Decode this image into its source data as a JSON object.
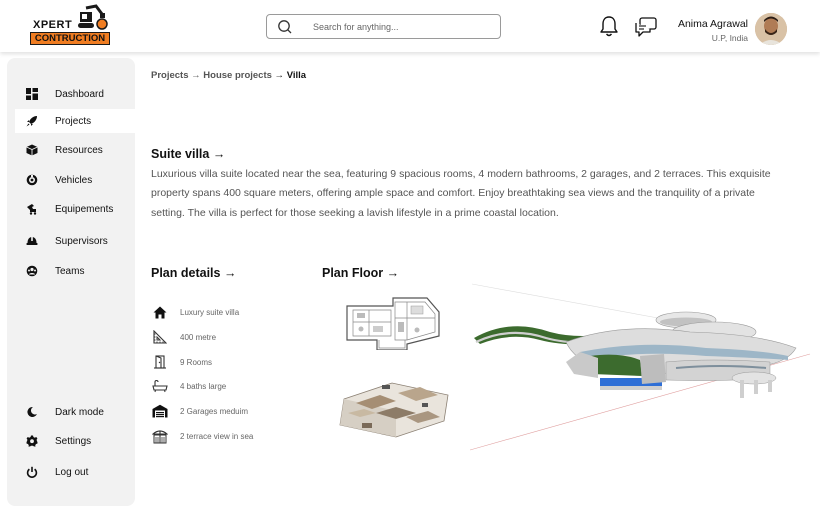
{
  "brand": {
    "logo_top": "XPERT",
    "logo_bottom": "CONTRUCTION"
  },
  "search": {
    "placeholder": "Search for anything..."
  },
  "header": {
    "icons": [
      "bell-icon",
      "chat-icon"
    ],
    "user": {
      "name": "Anima Agrawal",
      "location": "U.P, India"
    }
  },
  "sidebar": {
    "items": [
      {
        "label": "Dashboard",
        "icon": "grid-icon",
        "active": false
      },
      {
        "label": "Projects",
        "icon": "rocket-icon",
        "active": true
      },
      {
        "label": "Resources",
        "icon": "box-icon",
        "active": false
      },
      {
        "label": "Vehicles",
        "icon": "vehicle-icon",
        "active": false
      },
      {
        "label": "Equipements",
        "icon": "equipment-icon",
        "active": false
      },
      {
        "label": "Supervisors",
        "icon": "helmet-icon",
        "active": false
      },
      {
        "label": "Teams",
        "icon": "team-icon",
        "active": false
      }
    ],
    "bottom": [
      {
        "label": "Dark mode",
        "icon": "moon-icon"
      },
      {
        "label": "Settings",
        "icon": "gear-icon"
      },
      {
        "label": "Log out",
        "icon": "power-icon"
      }
    ]
  },
  "breadcrumb": {
    "projects": "Projects",
    "sep1": " → ",
    "house": "House projects",
    "sep2": " → ",
    "current": "Villa"
  },
  "project": {
    "title": "Suite villa →",
    "description": "Luxurious villa suite located near the sea, featuring 9 spacious rooms, 4 modern bathrooms, 2 garages, and 2 terraces. This exquisite property spans 400 square meters, offering ample space and comfort. Enjoy breathtaking sea views and the tranquility of a private setting. The villa is perfect for those seeking a lavish lifestyle in a prime coastal location."
  },
  "plan_details": {
    "title": "Plan details →",
    "items": [
      {
        "icon": "home-icon",
        "text": "Luxury suite villa"
      },
      {
        "icon": "area-icon",
        "text": "400 metre"
      },
      {
        "icon": "door-icon",
        "text": "9 Rooms"
      },
      {
        "icon": "bathtub-icon",
        "text": "4 baths large"
      },
      {
        "icon": "garage-icon",
        "text": "2 Garages meduim"
      },
      {
        "icon": "terrace-icon",
        "text": "2 terrace view in sea"
      }
    ]
  },
  "plan_floor": {
    "title": "Plan Floor →"
  },
  "colors": {
    "accent": "#f07d22",
    "sidebar_bg": "#f2f2f2",
    "text_muted": "#555555",
    "pool": "#2f6fd6",
    "lawn": "#3c6b2e"
  }
}
